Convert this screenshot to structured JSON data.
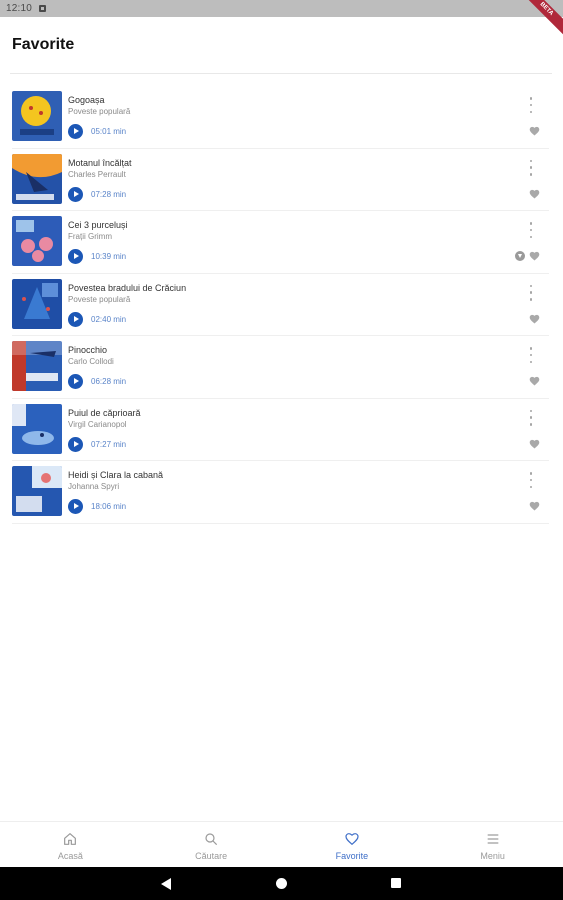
{
  "status_bar": {
    "time": "12:10",
    "badge": "BETA"
  },
  "page": {
    "title": "Favorite"
  },
  "colors": {
    "accent": "#1c57b6",
    "duration": "#5a84c9",
    "active_nav": "#3f6fc8",
    "inactive_nav": "#9a9a9a"
  },
  "stories": [
    {
      "title": "Gogoașa",
      "author": "Poveste populară",
      "duration": "05:01 min",
      "downloadable": false
    },
    {
      "title": "Motanul încălțat",
      "author": "Charles Perrault",
      "duration": "07:28 min",
      "downloadable": false
    },
    {
      "title": "Cei 3 purceluși",
      "author": "Frații Grimm",
      "duration": "10:39 min",
      "downloadable": true
    },
    {
      "title": "Povestea bradului de Crăciun",
      "author": "Poveste populară",
      "duration": "02:40 min",
      "downloadable": false
    },
    {
      "title": "Pinocchio",
      "author": "Carlo Collodi",
      "duration": "06:28 min",
      "downloadable": false
    },
    {
      "title": "Puiul de căprioară",
      "author": "Virgil Carianopol",
      "duration": "07:27 min",
      "downloadable": false
    },
    {
      "title": "Heidi și Clara la cabană",
      "author": "Johanna Spyri",
      "duration": "18:06 min",
      "downloadable": false
    }
  ],
  "bottom_nav": [
    {
      "label": "Acasă",
      "icon": "home-icon",
      "active": false
    },
    {
      "label": "Căutare",
      "icon": "search-icon",
      "active": false
    },
    {
      "label": "Favorite",
      "icon": "heart-icon",
      "active": true
    },
    {
      "label": "Meniu",
      "icon": "menu-icon",
      "active": false
    }
  ]
}
